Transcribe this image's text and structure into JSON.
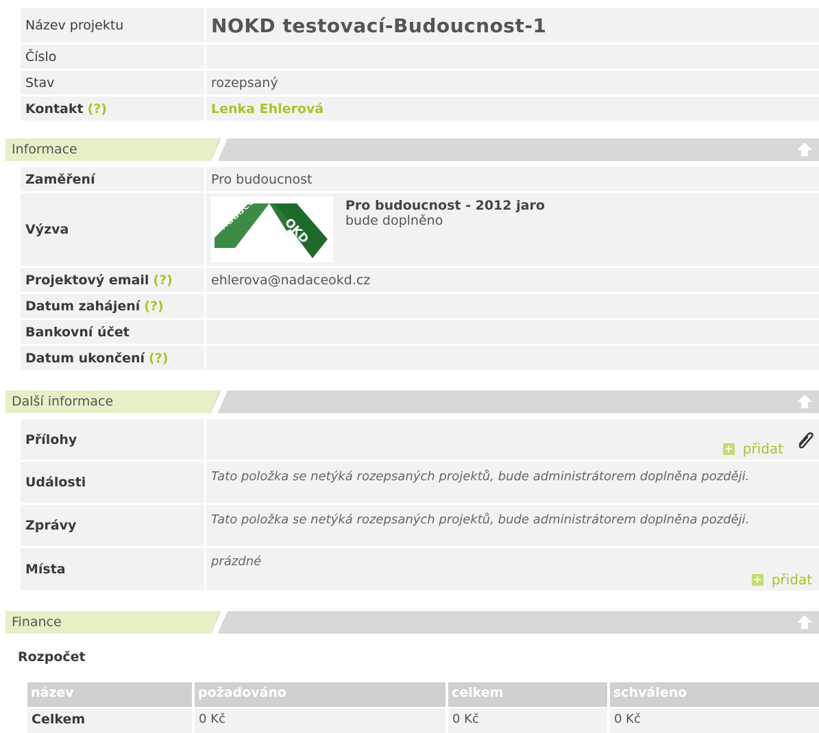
{
  "header": {
    "project_name_label": "Název projektu",
    "project_name_value": "NOKD testovací-Budoucnost-1",
    "number_label": "Číslo",
    "number_value": "",
    "state_label": "Stav",
    "state_value": "rozepsaný",
    "contact_label": "Kontakt",
    "contact_help": "(?)",
    "contact_value": "Lenka Ehlerová"
  },
  "sections": {
    "informace": "Informace",
    "dalsi": "Další informace",
    "finance": "Finance"
  },
  "informace": {
    "focus_label": "Zaměření",
    "focus_value": "Pro budoucnost",
    "call_label": "Výzva",
    "call_title": "Pro budoucnost - 2012 jaro",
    "call_subtitle": "bude doplněno",
    "logo_text_left": "nadace",
    "logo_text_right": "OKD",
    "email_label": "Projektový email",
    "email_help": "(?)",
    "email_value": "ehlerova@nadaceokd.cz",
    "start_label": "Datum zahájení",
    "start_help": "(?)",
    "bank_label": "Bankovní účet",
    "end_label": "Datum ukončení",
    "end_help": "(?)"
  },
  "dalsi": {
    "attachments_label": "Přílohy",
    "add_label": "přidat",
    "events_label": "Události",
    "events_value": "Tato položka se netýká rozepsaných projektů, bude administrátorem doplněna později.",
    "reports_label": "Zprávy",
    "reports_value": "Tato položka se netýká rozepsaných projektů, bude administrátorem doplněna později.",
    "places_label": "Místa",
    "places_value": "prázdné",
    "places_add": "přidat"
  },
  "finance": {
    "budget_title": "Rozpočet",
    "columns": [
      "název",
      "požadováno",
      "celkem",
      "schváleno"
    ],
    "rows": [
      [
        "Celkem",
        "0 Kč",
        "0 Kč",
        "0 Kč"
      ]
    ]
  },
  "colors": {
    "accent": "#a6c626",
    "section_bar": "#d8d8d8",
    "section_tab": "#e5f0c6",
    "row_bg": "#f2f2f2",
    "logo_green": "#3d8c46"
  }
}
